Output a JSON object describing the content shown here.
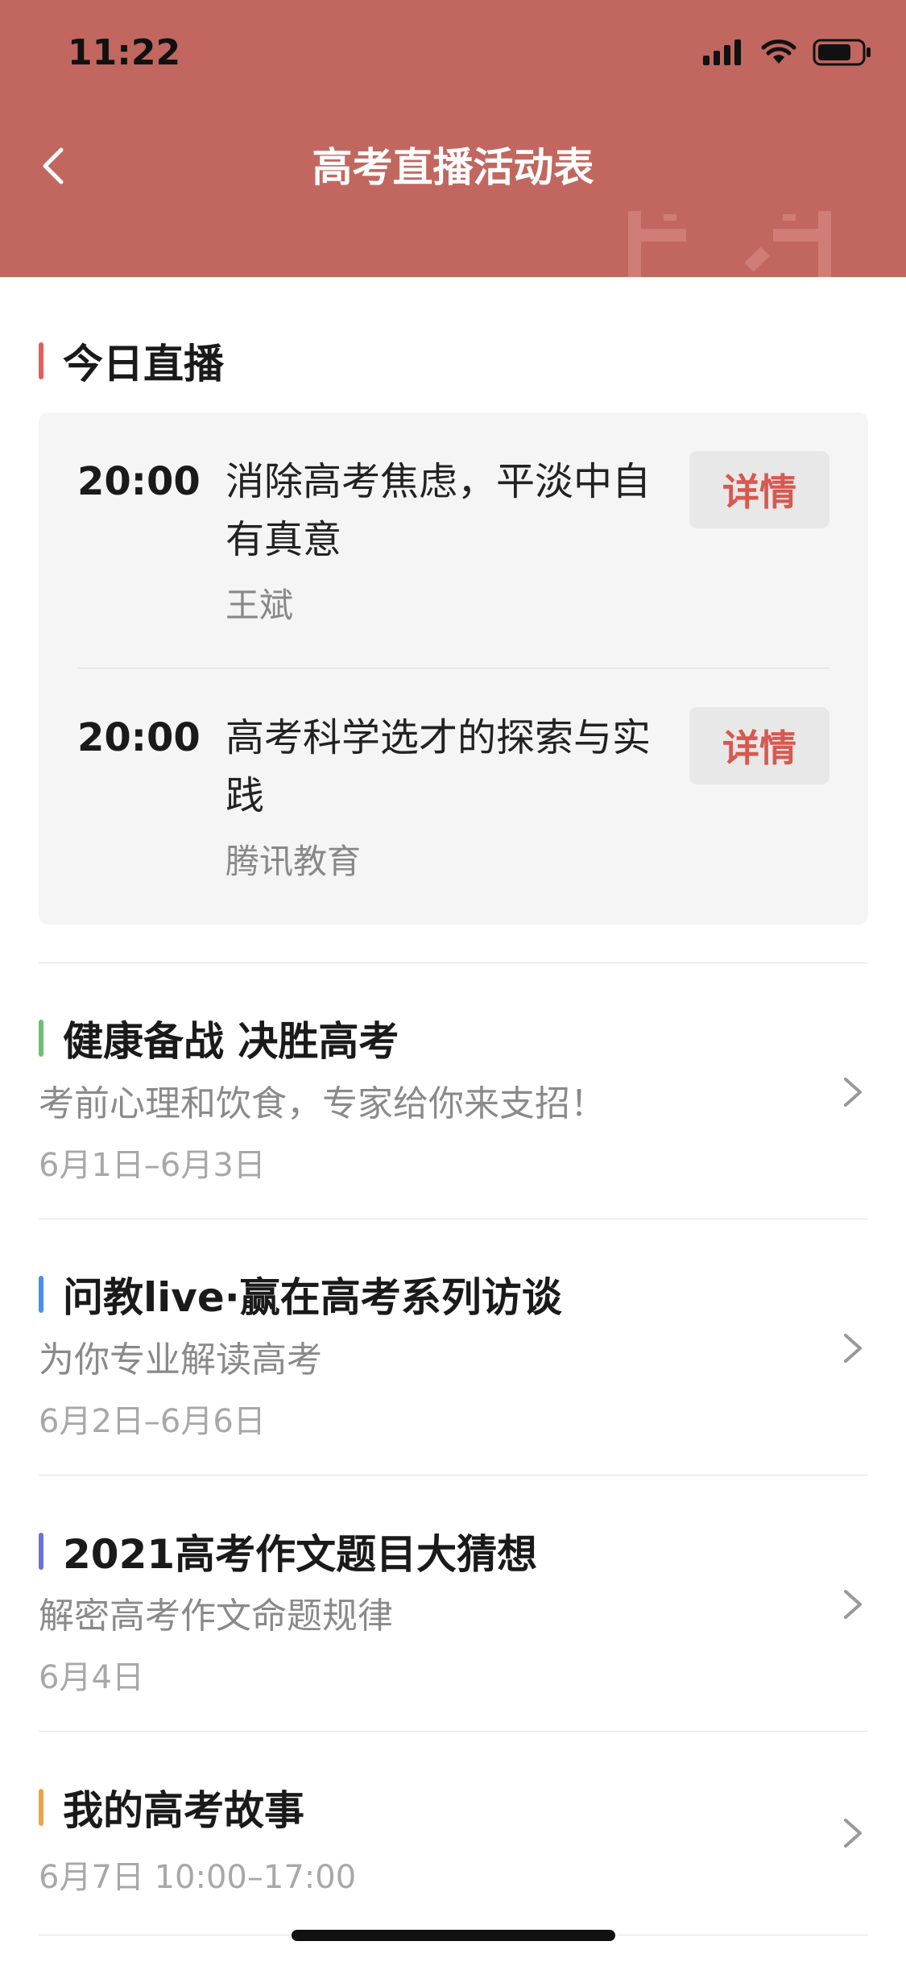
{
  "status_bar": {
    "time": "11:22"
  },
  "header": {
    "title": "高考直播活动表"
  },
  "today": {
    "heading": "今日直播",
    "accent": "#e0605a",
    "items": [
      {
        "time": "20:00",
        "title": "消除高考焦虑，平淡中自有真意",
        "host": "王斌",
        "button": "详情"
      },
      {
        "time": "20:00",
        "title": "高考科学选才的探索与实践",
        "host": "腾讯教育",
        "button": "详情"
      }
    ]
  },
  "activities": [
    {
      "title": "健康备战 决胜高考",
      "subtitle": "考前心理和饮食，专家给你来支招！",
      "date": "6月1日–6月3日",
      "accent": "#6cc070"
    },
    {
      "title": "问教live·赢在高考系列访谈",
      "subtitle": "为你专业解读高考",
      "date": "6月2日–6月6日",
      "accent": "#4a8ef0"
    },
    {
      "title": "2021高考作文题目大猜想",
      "subtitle": "解密高考作文命题规律",
      "date": "6月4日",
      "accent": "#6f6fd8"
    },
    {
      "title": "我的高考故事",
      "subtitle": "",
      "date": "6月7日 10:00–17:00",
      "accent": "#f0a24a"
    }
  ],
  "colors": {
    "header_bg": "#c1675f",
    "detail_text": "#d9584e"
  },
  "icons": {
    "back": "chevron-left-icon",
    "row_arrow": "chevron-right-icon",
    "signal": "signal-icon",
    "wifi": "wifi-icon",
    "battery": "battery-icon"
  }
}
